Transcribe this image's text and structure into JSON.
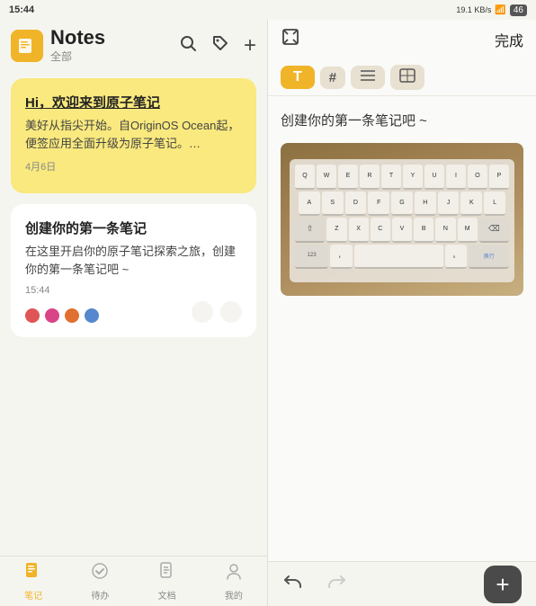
{
  "statusBar": {
    "time": "15:44",
    "rightIcons": "19.1 KB/s  WiFi  46"
  },
  "leftPanel": {
    "appIcon": "📒",
    "appTitle": "Notes",
    "appSubtitle": "全部",
    "headerActions": {
      "search": "🔍",
      "tag": "🏷",
      "add": "+"
    },
    "notes": [
      {
        "id": "note-1",
        "cardType": "yellow",
        "title": "Hi，欢迎来到原子笔记",
        "body": "美好从指尖开始。自OriginOS Ocean起，便签应用全面升级为原子笔记。…",
        "date": "4月6日",
        "colorDots": [],
        "hasActions": false
      },
      {
        "id": "note-2",
        "cardType": "white",
        "title": "创建你的第一条笔记",
        "body": "在这里开启你的原子笔记探索之旅，创建你的第一条笔记吧 ~",
        "date": "15:44",
        "colorDots": [
          "#e05555",
          "#d94488",
          "#e07030",
          "#5588cc"
        ],
        "hasActions": true
      }
    ]
  },
  "bottomNav": {
    "items": [
      {
        "id": "notes",
        "icon": "📋",
        "label": "笔记",
        "active": true
      },
      {
        "id": "todo",
        "icon": "✅",
        "label": "待办",
        "active": false
      },
      {
        "id": "doc",
        "icon": "📄",
        "label": "文档",
        "active": false
      },
      {
        "id": "mine",
        "icon": "👤",
        "label": "我的",
        "active": false
      }
    ]
  },
  "rightPanel": {
    "header": {
      "expandIcon": "⛶",
      "doneLabel": "完成"
    },
    "formatToolbar": {
      "buttons": [
        {
          "id": "text",
          "label": "T",
          "active": true
        },
        {
          "id": "hash",
          "label": "#",
          "active": false
        },
        {
          "id": "list",
          "label": "≡",
          "active": false
        },
        {
          "id": "table",
          "label": "⊞",
          "active": false
        }
      ]
    },
    "content": {
      "text": "创建你的第一条笔记吧 ~"
    },
    "bottomToolbar": {
      "undo": "↩",
      "redo": "↪",
      "add": "+"
    },
    "keyboardRows": [
      [
        "Q",
        "W",
        "E",
        "R",
        "T",
        "Y",
        "U",
        "I",
        "O",
        "P"
      ],
      [
        "A",
        "S",
        "D",
        "F",
        "G",
        "H",
        "J",
        "K",
        "L"
      ],
      [
        "⇧",
        "Z",
        "X",
        "C",
        "V",
        "B",
        "N",
        "M",
        "⌫"
      ],
      [
        "123",
        "，",
        "_space_",
        "。",
        "换行"
      ]
    ]
  }
}
